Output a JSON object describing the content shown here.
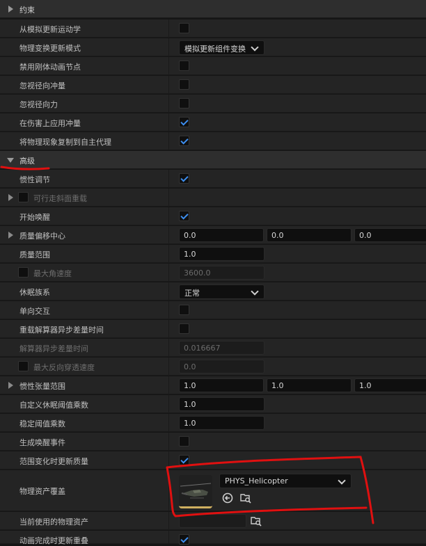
{
  "sections": {
    "constraints": "约束",
    "advanced": "高级"
  },
  "rows": {
    "update_kinematics": "从模拟更新运动学",
    "physics_transform_mode": "物理变换更新模式",
    "physics_transform_mode_value": "模拟更新组件变换",
    "disable_rigid_anim_node": "禁用刚体动画节点",
    "ignore_radial_impulse": "忽视径向冲量",
    "ignore_radial_force": "忽视径向力",
    "apply_impulse_on_damage": "在伤害上应用冲量",
    "replicate_physics_autonomous": "将物理现象复制到自主代理",
    "inertia_conditioning": "惯性调节",
    "walkable_slope_override": "可行走斜面重载",
    "start_awake": "开始唤醒",
    "com_nudge": "质量偏移中心",
    "com_x": "0.0",
    "com_y": "0.0",
    "com_z": "0.0",
    "mass_scale": "质量范围",
    "mass_scale_value": "1.0",
    "max_angular_velocity": "最大角速度",
    "max_angular_velocity_value": "3600.0",
    "sleep_family": "休眠族系",
    "sleep_family_value": "正常",
    "one_way_interaction": "单向交互",
    "override_async_delta": "重载解算器异步差量时间",
    "async_delta_time": "解算器异步差量时间",
    "async_delta_time_value": "0.016667",
    "max_depenetration": "最大反向穿透速度",
    "max_depenetration_value": "0.0",
    "inertia_tensor_scale": "惯性张量范围",
    "its_x": "1.0",
    "its_y": "1.0",
    "its_z": "1.0",
    "sleep_threshold_multiplier": "自定义休眠阈值乘数",
    "sleep_threshold_value": "1.0",
    "stabilization_multiplier": "稳定阈值乘数",
    "stabilization_value": "1.0",
    "generate_wake_events": "生成唤醒事件",
    "update_mass_on_scale": "范围变化时更新质量",
    "physics_asset_override": "物理资产覆盖",
    "physics_asset_name": "PHYS_Helicopter",
    "current_physics_asset": "当前使用的物理资产",
    "update_overlaps_anim_end": "动画完成时更新重叠"
  },
  "checks": {
    "update_kinematics": false,
    "disable_rigid_anim_node": false,
    "ignore_radial_impulse": false,
    "ignore_radial_force": false,
    "apply_impulse_on_damage": true,
    "replicate_physics_autonomous": true,
    "inertia_conditioning": true,
    "walkable_slope_override": false,
    "start_awake": true,
    "max_angular_velocity_enabled": false,
    "one_way_interaction": false,
    "override_async_delta": false,
    "max_depenetration_enabled": false,
    "generate_wake_events": false,
    "update_mass_on_scale": true,
    "update_overlaps_anim_end": true
  },
  "colors": {
    "accent": "#3d8eef",
    "annotation": "#e01010",
    "panel": "#242424"
  },
  "icons": {
    "use_selected": "use-selected-asset-icon",
    "browse": "browse-asset-icon"
  }
}
